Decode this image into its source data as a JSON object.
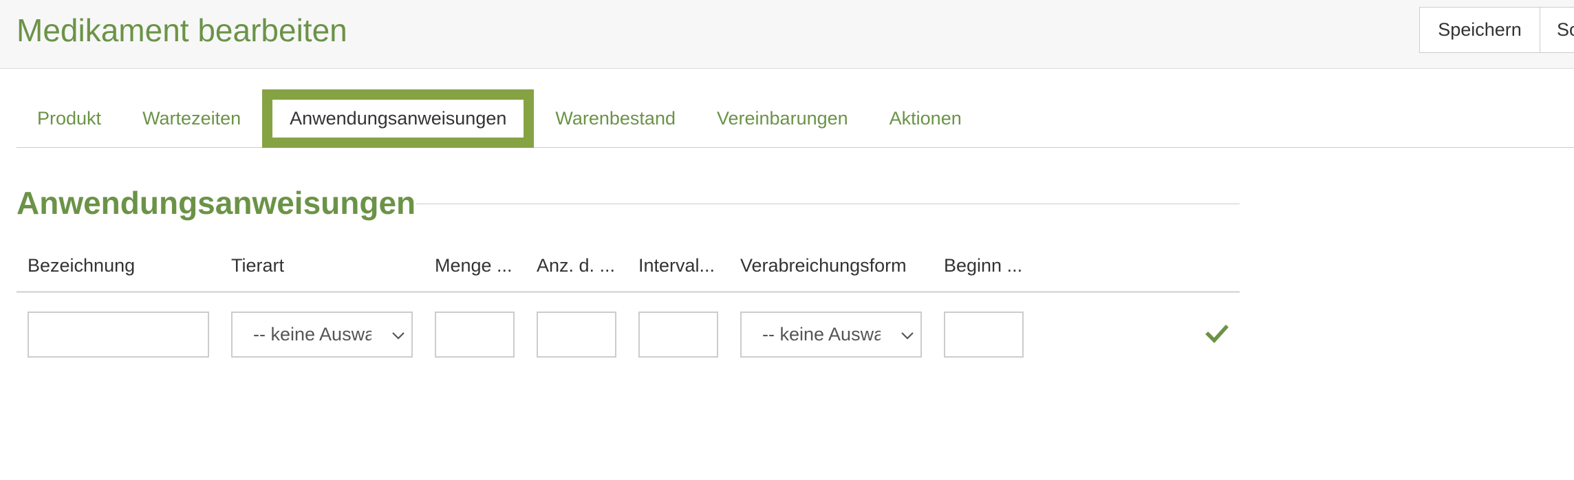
{
  "header": {
    "title": "Medikament bearbeiten",
    "save_label": "Speichern",
    "second_button_label": "So"
  },
  "tabs": [
    {
      "label": "Produkt",
      "active": false
    },
    {
      "label": "Wartezeiten",
      "active": false
    },
    {
      "label": "Anwendungsanweisungen",
      "active": true
    },
    {
      "label": "Warenbestand",
      "active": false
    },
    {
      "label": "Vereinbarungen",
      "active": false
    },
    {
      "label": "Aktionen",
      "active": false
    }
  ],
  "section": {
    "title": "Anwendungsanweisungen"
  },
  "table": {
    "columns": [
      "Bezeichnung",
      "Tierart",
      "Menge ...",
      "Anz. d. ...",
      "Interval...",
      "Verabreichungsform",
      "Beginn ..."
    ],
    "row": {
      "bezeichnung": "",
      "tierart": "-- keine Auswahl --",
      "menge": "",
      "anzahl": "",
      "interval": "",
      "verabreichungsform": "-- keine Auswahl --",
      "beginn": ""
    }
  },
  "colors": {
    "accent": "#6b9347",
    "active_tab_border": "#86a344",
    "header_bg": "#f7f7f7"
  },
  "icons": {
    "confirm": "checkmark-icon",
    "dropdown": "chevron-down-icon"
  }
}
